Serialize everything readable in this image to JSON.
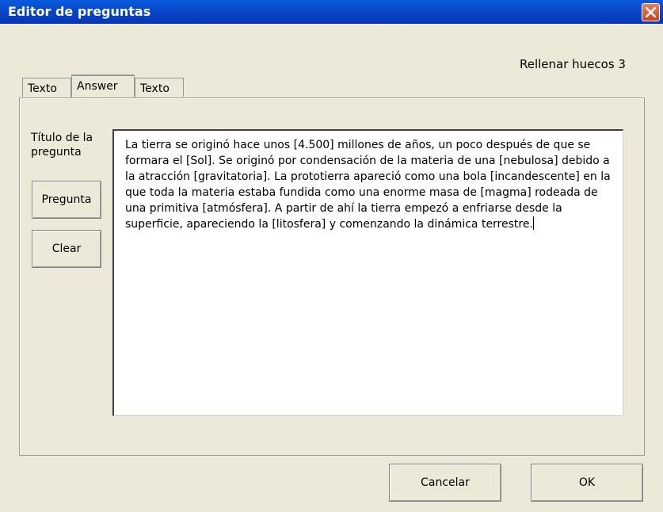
{
  "window": {
    "title": "Editor de preguntas",
    "variant_label": "Rellenar huecos 3",
    "title_color": "#0847C8",
    "close_color": "#C8441F"
  },
  "tabs": [
    {
      "label": "Texto",
      "active": false
    },
    {
      "label": "Answer",
      "active": true
    },
    {
      "label": "Texto",
      "active": false
    }
  ],
  "sidebar": {
    "question_title_label": "Título de la pregunta",
    "pregunta_button": "Pregunta",
    "clear_button": "Clear"
  },
  "editor": {
    "text": "La tierra se originó hace unos [4.500] millones de años, un poco después de que se formara el [Sol]. Se originó por condensación de la materia de una [nebulosa] debido a la atracción [gravitatoria]. La prototierra apareció como una bola [incandescente] en la que toda la materia estaba fundida como una enorme masa de [magma] rodeada de una primitiva [atmósfera]. A partir de ahí la tierra empezó a enfriarse desde la superficie, apareciendo la [litosfera] y comenzando la dinámica terrestre."
  },
  "footer": {
    "cancel_button": "Cancelar",
    "ok_button": "OK"
  }
}
